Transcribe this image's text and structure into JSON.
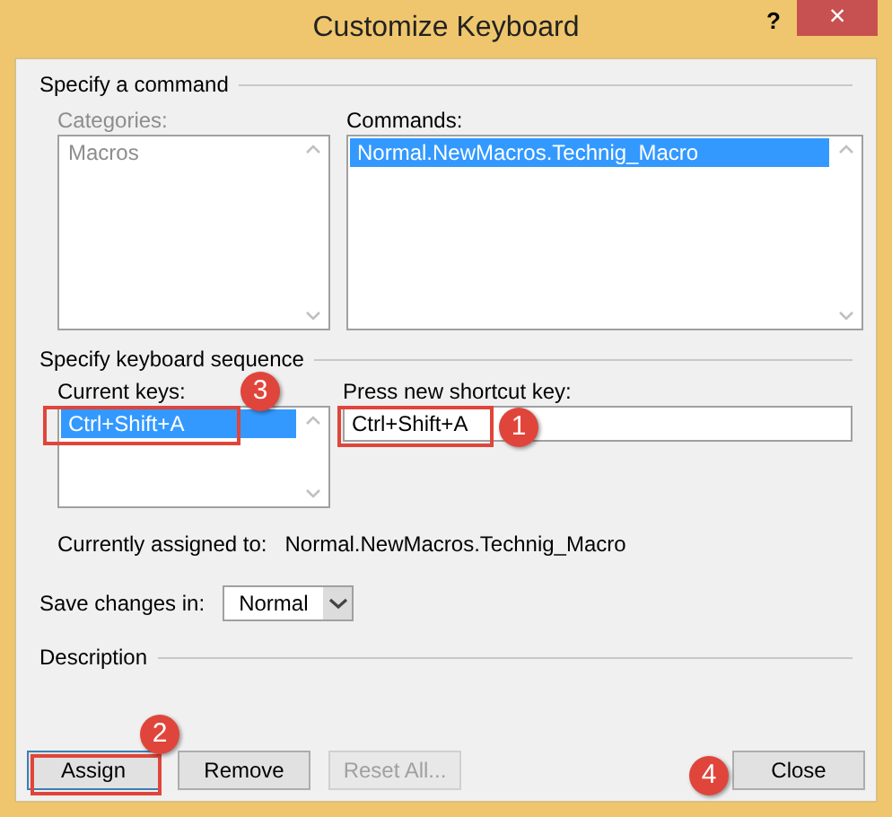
{
  "window": {
    "title": "Customize Keyboard",
    "help": "?",
    "close": "×"
  },
  "command_section": {
    "title": "Specify a command",
    "categories": {
      "label": "Categories:",
      "disabled": true,
      "items": [
        {
          "text": "Macros",
          "selected": false
        }
      ]
    },
    "commands": {
      "label": "Commands:",
      "disabled": false,
      "items": [
        {
          "text": "Normal.NewMacros.Technig_Macro",
          "selected": true
        }
      ]
    }
  },
  "keyboard_section": {
    "title": "Specify keyboard sequence",
    "current_keys": {
      "label": "Current keys:",
      "items": [
        {
          "text": "Ctrl+Shift+A",
          "selected": true
        }
      ],
      "highlighted": true,
      "callout": "3"
    },
    "new_shortcut": {
      "label": "Press new shortcut key:",
      "value": "Ctrl+Shift+A",
      "highlighted": true,
      "callout": "1"
    },
    "assigned_label": "Currently assigned to:",
    "assigned_value": "Normal.NewMacros.Technig_Macro",
    "save_label": "Save changes in:",
    "save_value": "Normal"
  },
  "description": {
    "title": "Description"
  },
  "buttons": [
    {
      "label": "Assign",
      "disabled": false,
      "highlighted": true,
      "callout": "2"
    },
    {
      "label": "Remove",
      "disabled": false
    },
    {
      "label": "Reset All...",
      "disabled": true
    },
    {
      "label": "Close",
      "disabled": false,
      "callout": "4"
    }
  ]
}
